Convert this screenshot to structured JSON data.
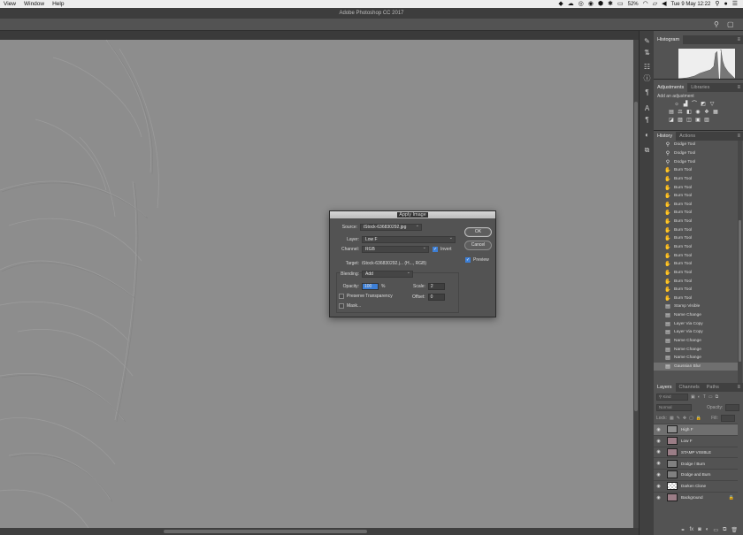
{
  "menubar": {
    "items": [
      "View",
      "Window",
      "Help"
    ],
    "battery": "52%",
    "datetime": "Tue 9 May  12:22"
  },
  "app": {
    "title": "Adobe Photoshop CC 2017"
  },
  "panels": {
    "histogram": {
      "tabs": [
        "Histogram"
      ]
    },
    "adjustments": {
      "tabs": [
        "Adjustments",
        "Libraries"
      ],
      "label": "Add an adjustment"
    },
    "history": {
      "tabs": [
        "History",
        "Actions"
      ],
      "items": [
        {
          "label": "Dodge Tool",
          "icon": "dodge-icon"
        },
        {
          "label": "Dodge Tool",
          "icon": "dodge-icon"
        },
        {
          "label": "Dodge Tool",
          "icon": "dodge-icon"
        },
        {
          "label": "Burn Tool",
          "icon": "burn-icon"
        },
        {
          "label": "Burn Tool",
          "icon": "burn-icon"
        },
        {
          "label": "Burn Tool",
          "icon": "burn-icon"
        },
        {
          "label": "Burn Tool",
          "icon": "burn-icon"
        },
        {
          "label": "Burn Tool",
          "icon": "burn-icon"
        },
        {
          "label": "Burn Tool",
          "icon": "burn-icon"
        },
        {
          "label": "Burn Tool",
          "icon": "burn-icon"
        },
        {
          "label": "Burn Tool",
          "icon": "burn-icon"
        },
        {
          "label": "Burn Tool",
          "icon": "burn-icon"
        },
        {
          "label": "Burn Tool",
          "icon": "burn-icon"
        },
        {
          "label": "Burn Tool",
          "icon": "burn-icon"
        },
        {
          "label": "Burn Tool",
          "icon": "burn-icon"
        },
        {
          "label": "Burn Tool",
          "icon": "burn-icon"
        },
        {
          "label": "Burn Tool",
          "icon": "burn-icon"
        },
        {
          "label": "Burn Tool",
          "icon": "burn-icon"
        },
        {
          "label": "Burn Tool",
          "icon": "burn-icon"
        },
        {
          "label": "Stamp Visible",
          "icon": "step-icon"
        },
        {
          "label": "Name Change",
          "icon": "step-icon"
        },
        {
          "label": "Layer Via Copy",
          "icon": "step-icon"
        },
        {
          "label": "Layer Via Copy",
          "icon": "step-icon"
        },
        {
          "label": "Name Change",
          "icon": "step-icon"
        },
        {
          "label": "Name Change",
          "icon": "step-icon"
        },
        {
          "label": "Name Change",
          "icon": "step-icon"
        },
        {
          "label": "Gaussian Blur",
          "icon": "step-icon",
          "selected": true
        }
      ]
    },
    "layers": {
      "tabs": [
        "Layers",
        "Channels",
        "Paths"
      ],
      "filter_kind": "Kind",
      "blend_mode": "Normal",
      "opacity_label": "Opacity:",
      "lock_label": "Lock:",
      "fill_label": "Fill:",
      "items": [
        {
          "name": "High F",
          "thumb": "#8f8f8f",
          "selected": true,
          "visible": true
        },
        {
          "name": "Low F",
          "thumb": "#9a7d86",
          "visible": true
        },
        {
          "name": "STAMP VISIBLE",
          "thumb": "#9a7d86",
          "visible": true
        },
        {
          "name": "Dodge / Burn",
          "thumb": "#808080",
          "visible": true
        },
        {
          "name": "Dodge and Burn",
          "thumb": "#808080",
          "visible": true
        },
        {
          "name": "Darken Clone",
          "thumb": "checker",
          "visible": true
        },
        {
          "name": "Background",
          "thumb": "#9a7d86",
          "visible": true,
          "locked": true
        }
      ]
    }
  },
  "dialog": {
    "title": "Apply Image",
    "source_label": "Source:",
    "source_value": "iStock-636830292.jpg",
    "layer_label": "Layer:",
    "layer_value": "Low F",
    "channel_label": "Channel:",
    "channel_value": "RGB",
    "invert_label": "Invert",
    "target_label": "Target:",
    "target_value": "iStock-636830292.j... (H..., RGB)",
    "blending_label": "Blending:",
    "blending_value": "Add",
    "opacity_label": "Opacity:",
    "opacity_value": "100",
    "opacity_unit": "%",
    "scale_label": "Scale:",
    "scale_value": "2",
    "offset_label": "Offset:",
    "offset_value": "0",
    "preserve_label": "Preserve Transparency",
    "mask_label": "Mask...",
    "ok_label": "OK",
    "cancel_label": "Cancel",
    "preview_label": "Preview"
  }
}
